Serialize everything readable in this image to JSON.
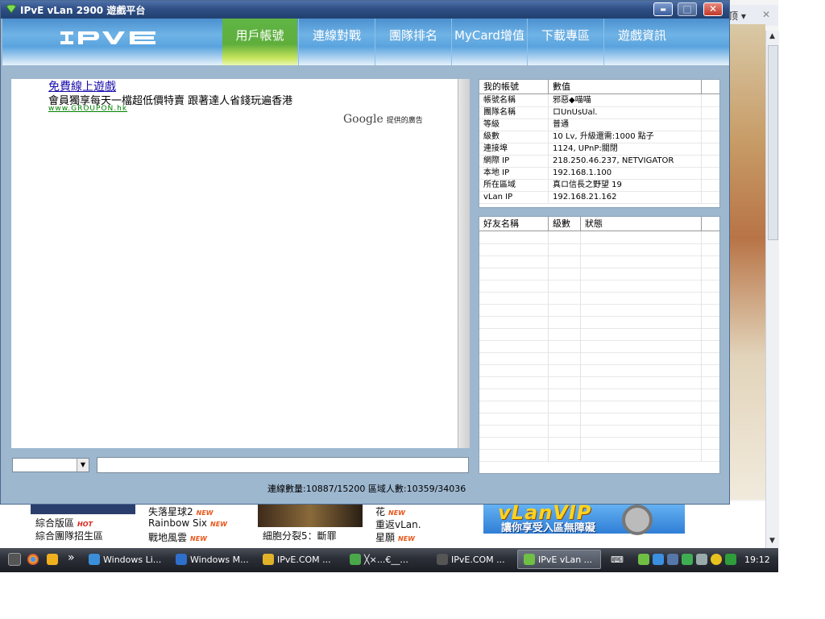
{
  "window": {
    "title": "IPvE vLan 2900 遊戲平台",
    "controls": {
      "minimize": "▬",
      "maximize": "□",
      "close": "✕"
    }
  },
  "nav": {
    "logo": "IPVE",
    "tabs": [
      {
        "label": "用戶帳號",
        "active": true
      },
      {
        "label": "連線對戰",
        "active": false
      },
      {
        "label": "團隊排名",
        "active": false
      },
      {
        "label": "MyCard增值",
        "active": false
      },
      {
        "label": "下載專區",
        "active": false
      },
      {
        "label": "遊戲資訊",
        "active": false
      }
    ]
  },
  "ad": {
    "title": "免費線上遊戲",
    "description": "會員獨享每天一檔超低價特賣  跟著達人省錢玩遍香港",
    "url": "www.GROUPON.hk",
    "google_brand": "Google",
    "google_caption": "提供的廣告"
  },
  "account_table": {
    "headers": [
      "我的帳號",
      "數值"
    ],
    "rows": [
      [
        "帳號名稱",
        "邪惡◆喵喵"
      ],
      [
        "團隊名稱",
        "ロUnUsUal."
      ],
      [
        "等級",
        "普通"
      ],
      [
        "級數",
        "10 Lv, 升級還需:1000 點子"
      ],
      [
        "連接埠",
        "1124, UPnP:關閉"
      ],
      [
        "網際 IP",
        "218.250.46.237, NETVIGATOR"
      ],
      [
        "本地 IP",
        "192.168.1.100"
      ],
      [
        "所在區域",
        "真ロ信長之野望 19"
      ],
      [
        "vLan IP",
        "192.168.21.162"
      ]
    ]
  },
  "friends_table": {
    "headers": [
      "好友名稱",
      "級數",
      "狀態"
    ],
    "rows": []
  },
  "status_bar": {
    "text": "連線數量:10887/15200    區域人數:10359/34036"
  },
  "background_page": {
    "top_right_text": "顶 ▾",
    "top_right_close": "✕",
    "col1": [
      {
        "text": "綜合版區",
        "badge": "HOT"
      },
      {
        "text": "綜合團隊招生區",
        "badge": ""
      }
    ],
    "col2": [
      {
        "text": "失落星球2",
        "badge": "NEW"
      },
      {
        "text": "Rainbow Six",
        "badge": "NEW"
      },
      {
        "text": "戰地風雲",
        "badge": "NEW"
      }
    ],
    "col3": [
      {
        "text": "細胞分裂5：斷罪",
        "badge": ""
      }
    ],
    "col4": [
      {
        "text": "花",
        "badge": "NEW"
      },
      {
        "text": "重返vLan.",
        "badge": ""
      },
      {
        "text": "星願",
        "badge": "NEW"
      }
    ],
    "vip_banner": {
      "title": "vLanVIP",
      "subtitle": "讓你享受入區無障礙"
    }
  },
  "taskbar": {
    "items": [
      {
        "label": "Windows Li...",
        "icon": "windows-live-icon",
        "color": "#3b8fd9"
      },
      {
        "label": "Windows M...",
        "icon": "windows-media-icon",
        "color": "#2f6fcc"
      },
      {
        "label": "IPvE.COM ...",
        "icon": "chrome-icon",
        "color": "#e0b22a"
      },
      {
        "label": "╳×...€__...",
        "icon": "messenger-icon",
        "color": "#4aa84a"
      },
      {
        "label": "IPvE.COM ...",
        "icon": "app-window-icon",
        "color": "#555"
      },
      {
        "label": "IPvE vLan ...",
        "icon": "ipve-icon",
        "color": "#6fbf45",
        "active": true
      }
    ],
    "more": "»",
    "clock": "19:12"
  }
}
